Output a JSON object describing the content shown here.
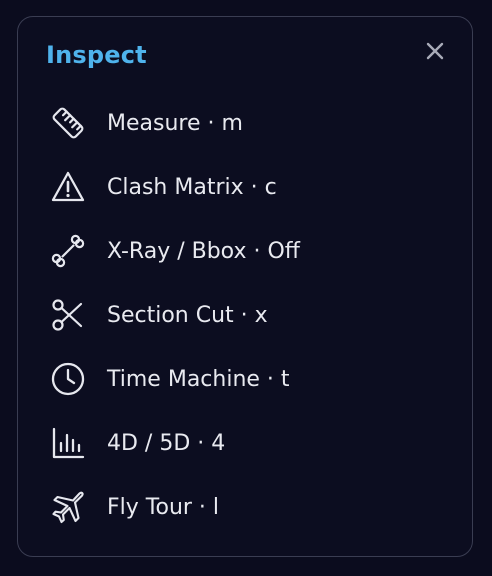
{
  "panel": {
    "title": "Inspect",
    "close_icon": "close-icon"
  },
  "menu": {
    "items": [
      {
        "icon": "ruler-icon",
        "label": "Measure · m"
      },
      {
        "icon": "warning-triangle-icon",
        "label": "Clash Matrix · c"
      },
      {
        "icon": "bone-icon",
        "label": "X-Ray / Bbox · Off"
      },
      {
        "icon": "scissors-icon",
        "label": "Section Cut · x"
      },
      {
        "icon": "clock-icon",
        "label": "Time Machine · t"
      },
      {
        "icon": "bar-chart-icon",
        "label": "4D / 5D · 4"
      },
      {
        "icon": "airplane-icon",
        "label": "Fly Tour · l"
      }
    ]
  },
  "colors": {
    "background": "#0b0c1e",
    "panel_border": "#3a3d52",
    "title": "#4fb3ec",
    "text": "#e9eaf0"
  }
}
